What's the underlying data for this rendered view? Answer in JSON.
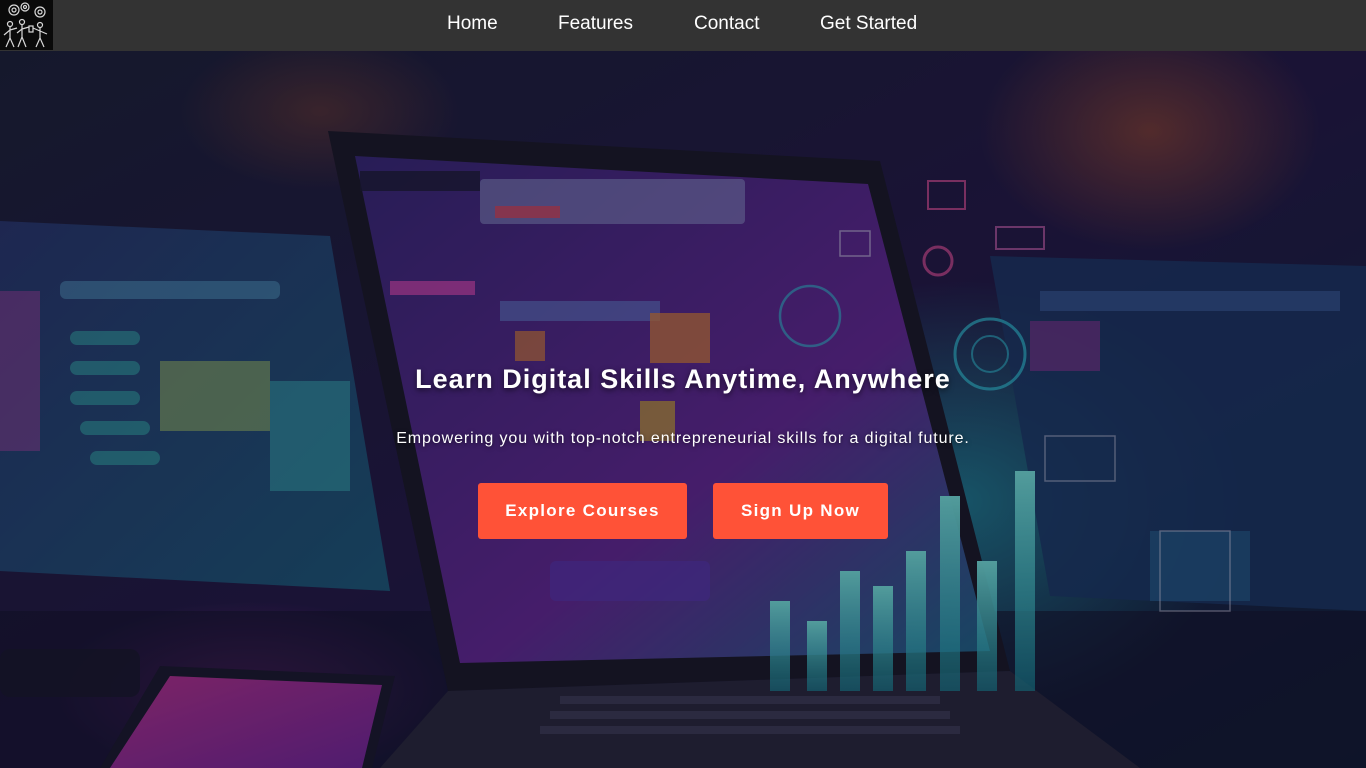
{
  "nav": {
    "logo_icon": "teamwork-gears-logo",
    "links": [
      {
        "label": "Home"
      },
      {
        "label": "Features"
      },
      {
        "label": "Contact"
      },
      {
        "label": "Get Started"
      }
    ]
  },
  "hero": {
    "title": "Learn Digital Skills Anytime, Anywhere",
    "subtitle": "Empowering you with top-notch entrepreneurial skills for a digital future.",
    "buttons": {
      "explore_label": "Explore Courses",
      "signup_label": "Sign Up Now"
    }
  },
  "colors": {
    "nav_background": "#333333",
    "button_accent": "#ff5237",
    "text": "#ffffff"
  }
}
